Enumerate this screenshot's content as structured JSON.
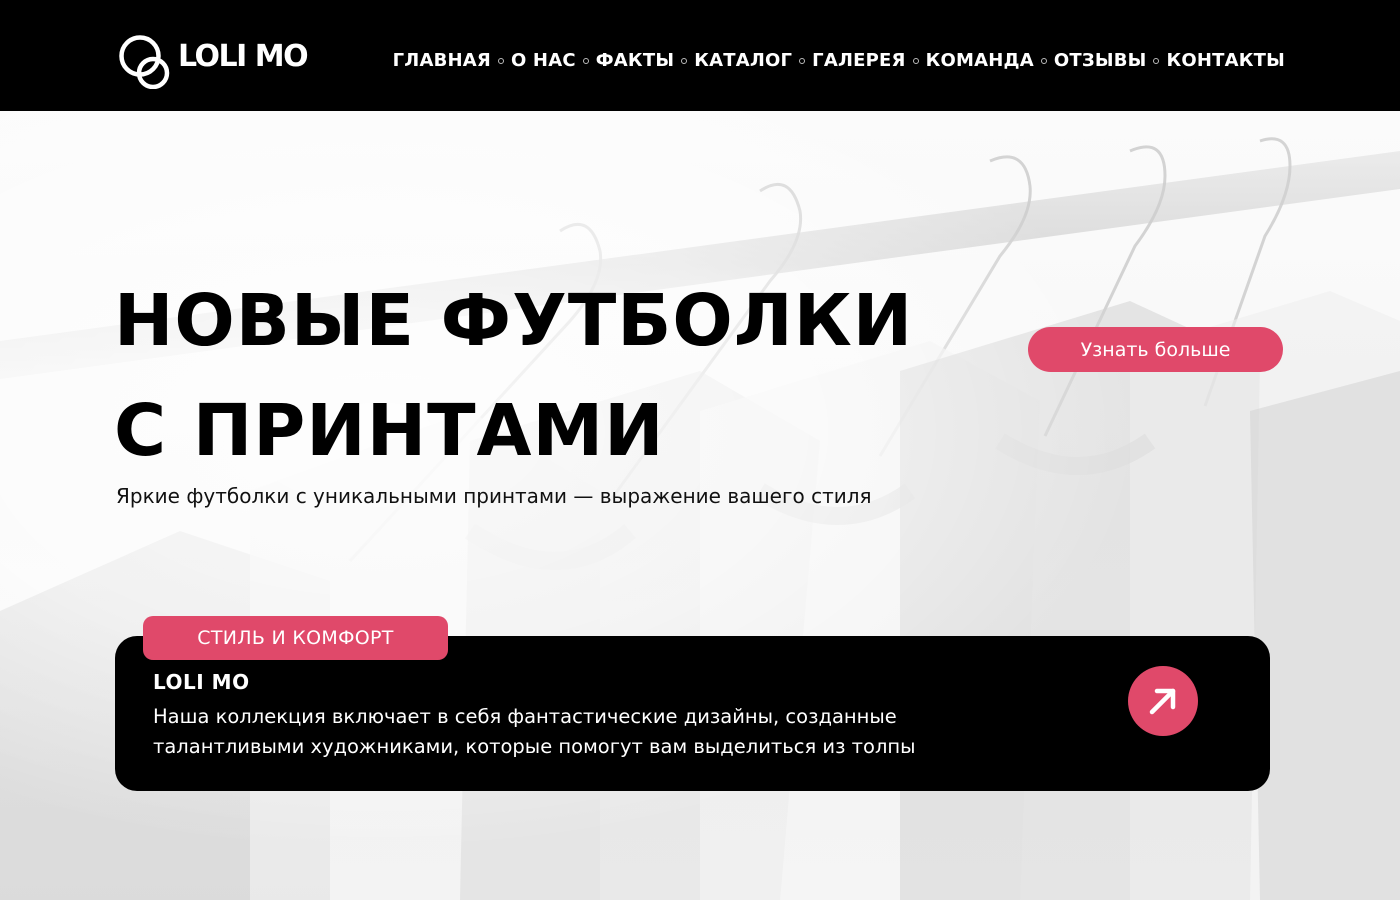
{
  "brand": {
    "name": "LOLI MO",
    "logo_icon": "double-ring-logo-icon"
  },
  "nav": {
    "items": [
      {
        "label": "ГЛАВНАЯ"
      },
      {
        "label": "О НАС"
      },
      {
        "label": "ФАКТЫ"
      },
      {
        "label": "КАТАЛОГ"
      },
      {
        "label": "ГАЛЕРЕЯ"
      },
      {
        "label": "КОМАНДА"
      },
      {
        "label": "ОТЗЫВЫ"
      },
      {
        "label": "КОНТАКТЫ"
      }
    ],
    "separator_icon": "small-circle-separator-icon"
  },
  "hero": {
    "title_line1": "НОВЫЕ ФУТБОЛКИ",
    "title_line2": "С ПРИНТАМИ",
    "subtitle": "Яркие футболки с уникальными принтами — выражение вашего стиля",
    "cta_label": "Узнать больше",
    "background_icon": "clothes-rack-hangers-photo"
  },
  "card": {
    "tag": "СТИЛЬ И КОМФОРТ",
    "title": "LOLI MO",
    "text": "Наша коллекция включает в себя фантастические дизайны, созданные талантливыми художниками, которые помогут вам выделиться из толпы",
    "arrow_icon": "arrow-up-right-icon"
  },
  "colors": {
    "header_bg": "#000000",
    "accent": "#e0496a",
    "card_bg": "#000000",
    "text_primary": "#000000",
    "text_on_dark": "#ffffff"
  }
}
